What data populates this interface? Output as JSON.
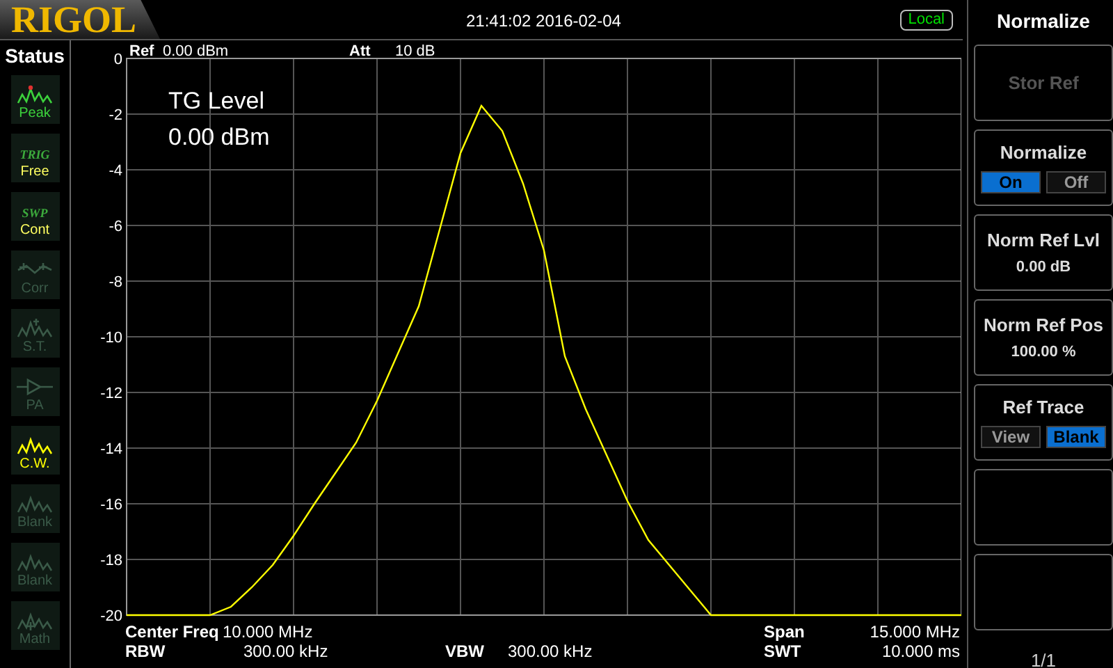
{
  "header": {
    "logo": "RIGOL",
    "datetime": "21:41:02 2016-02-04",
    "remote_state": "Local"
  },
  "status": {
    "title": "Status",
    "items": [
      {
        "kind": "peak",
        "label": "Peak",
        "color": "#3cd23c"
      },
      {
        "kind": "text",
        "caption": "TRIG",
        "label": "Free",
        "color": "#ffff60"
      },
      {
        "kind": "text",
        "caption": "SWP",
        "label": "Cont",
        "color": "#ffff60"
      },
      {
        "kind": "corr",
        "label": "Corr",
        "color": "#3a5a48"
      },
      {
        "kind": "st",
        "label": "S.T.",
        "color": "#3a5a48"
      },
      {
        "kind": "pa",
        "label": "PA",
        "color": "#3a5a48"
      },
      {
        "kind": "wave",
        "label": "C.W.",
        "color": "#ffff00"
      },
      {
        "kind": "wave",
        "label": "Blank",
        "color": "#3a5a48"
      },
      {
        "kind": "wave",
        "label": "Blank",
        "color": "#3a5a48"
      },
      {
        "kind": "math",
        "label": "Math",
        "color": "#3a5a48"
      }
    ]
  },
  "plot": {
    "ref_label": "Ref",
    "ref_value": "0.00 dBm",
    "att_label": "Att",
    "att_value": "10 dB",
    "overlay": [
      "TG Level",
      "0.00 dBm"
    ],
    "chart_data": {
      "type": "line",
      "categories": [
        null,
        null,
        null,
        null,
        null,
        null,
        null,
        null,
        null,
        null,
        null,
        null,
        null,
        null,
        null,
        null,
        null,
        null,
        null,
        null,
        null,
        null,
        null,
        null,
        null,
        null,
        null,
        null,
        null,
        null,
        null,
        null,
        null,
        null,
        null,
        null,
        null,
        null,
        null,
        null,
        null
      ],
      "ylim": [
        -20,
        0
      ],
      "grid": true,
      "yticks": [
        0,
        -2,
        -4,
        -6,
        -8,
        -10,
        -12,
        -14,
        -16,
        -18,
        -20
      ],
      "series": [
        {
          "color": "#ffff00",
          "values": [
            -20,
            -20,
            -20,
            -20,
            -20,
            -19.7,
            -19,
            -18.2,
            -17.15,
            -16,
            -14.9,
            -13.8,
            -12.3,
            -10.6,
            -8.9,
            -6.15,
            -3.4,
            -1.7,
            -2.6,
            -4.5,
            -6.9,
            -10.7,
            -12.6,
            -14.25,
            -15.9,
            -17.3,
            -18.2,
            -19.1,
            -20,
            -20,
            -20,
            -20,
            -20,
            -20,
            -20,
            -20,
            -20,
            -20,
            -20,
            -20,
            -20
          ]
        }
      ]
    }
  },
  "readouts": [
    [
      {
        "label": "Center Freq",
        "value": "10.000 MHz"
      },
      {
        "label": "Span",
        "value": "15.000 MHz"
      }
    ],
    [
      {
        "label": "RBW",
        "value": "300.00 kHz"
      },
      {
        "label": "VBW",
        "value": "300.00 kHz"
      },
      {
        "label": "SWT",
        "value": "10.000 ms"
      }
    ]
  ],
  "menu": {
    "title": "Normalize",
    "items": [
      {
        "kind": "action",
        "label": "Stor Ref",
        "disabled": true
      },
      {
        "kind": "toggle",
        "label": "Normalize",
        "options": [
          {
            "label": "On",
            "selected": true
          },
          {
            "label": "Off",
            "selected": false
          }
        ]
      },
      {
        "kind": "value",
        "label": "Norm Ref Lvl",
        "value": "0.00 dB"
      },
      {
        "kind": "value",
        "label": "Norm Ref Pos",
        "value": "100.00 %"
      },
      {
        "kind": "toggle",
        "label": "Ref Trace",
        "options": [
          {
            "label": "View",
            "selected": false
          },
          {
            "label": "Blank",
            "selected": true
          }
        ]
      },
      {
        "kind": "empty"
      },
      {
        "kind": "empty"
      }
    ],
    "page": "1/1"
  }
}
